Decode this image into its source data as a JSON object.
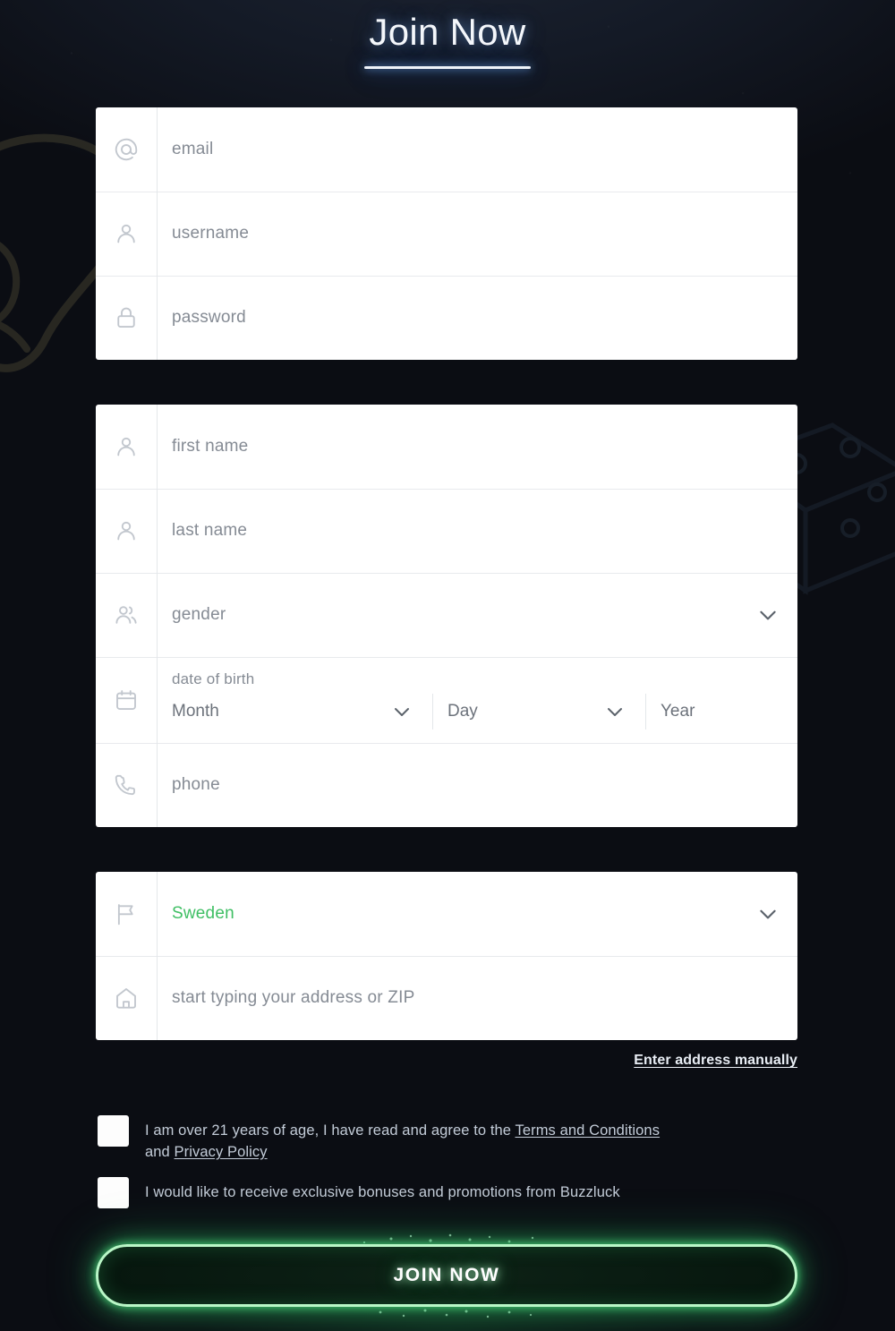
{
  "page": {
    "title": "Join Now",
    "brand_accent": "#3fbf64",
    "title_glow": "#6fa8dc",
    "background": "#0c0e14"
  },
  "account_card": {
    "fields": [
      {
        "icon": "at-icon",
        "placeholder": "email"
      },
      {
        "icon": "user-icon",
        "placeholder": "username"
      },
      {
        "icon": "lock-icon",
        "placeholder": "password"
      }
    ]
  },
  "personal_card": {
    "first_name": {
      "icon": "user-icon",
      "placeholder": "first name"
    },
    "last_name": {
      "icon": "user-icon",
      "placeholder": "last name"
    },
    "gender": {
      "icon": "users-icon",
      "placeholder": "gender",
      "chevron": "chevron-down-icon"
    },
    "dob": {
      "icon": "calendar-icon",
      "label": "date of birth",
      "month": "Month",
      "day": "Day",
      "year": "Year"
    },
    "phone": {
      "icon": "phone-icon",
      "placeholder": "phone"
    }
  },
  "address_card": {
    "country": {
      "icon": "flag-icon",
      "value": "Sweden",
      "color": "#3fbf64",
      "chevron": "chevron-down-icon"
    },
    "address": {
      "icon": "home-icon",
      "placeholder": "start typing your address or ZIP"
    }
  },
  "manual_address_link": "Enter address manually",
  "consents": [
    {
      "name": "age-terms",
      "checked": false,
      "text_parts": [
        {
          "type": "text",
          "value": "I am over 21 years of age, I have read and agree to the "
        },
        {
          "type": "link",
          "value": "Terms and Conditions"
        },
        {
          "type": "text",
          "value": " and "
        },
        {
          "type": "link",
          "value": "Privacy Policy"
        }
      ]
    },
    {
      "name": "promotions",
      "checked": false,
      "text_parts": [
        {
          "type": "text",
          "value": "I would like to receive exclusive bonuses and promotions from Buzzluck"
        }
      ]
    }
  ],
  "submit_button": {
    "label": "JOIN NOW",
    "accent": "#b9f7c7"
  }
}
